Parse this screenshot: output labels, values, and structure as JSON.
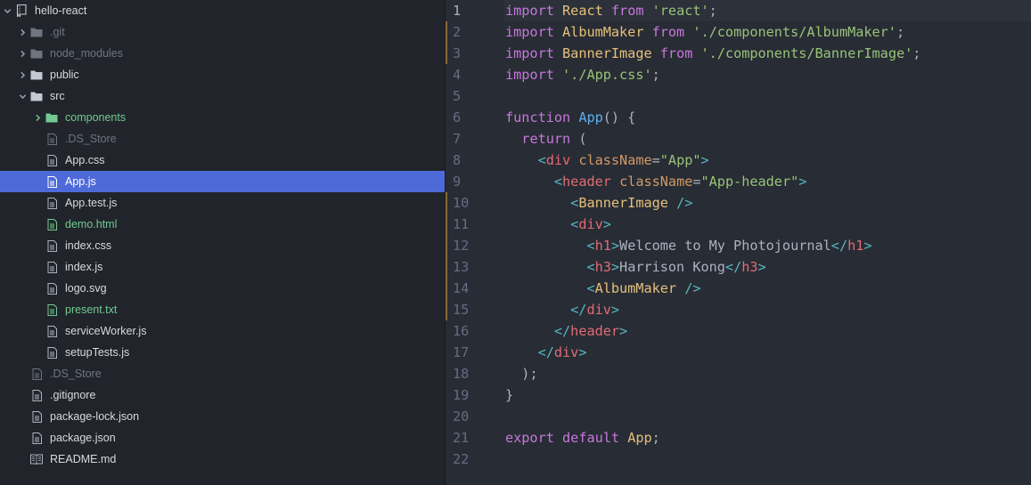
{
  "colors": {
    "tree_bg": "#21252b",
    "editor_bg": "#282c34",
    "selection": "#4e6ad8",
    "added": "#73c991",
    "ignored": "#6e7480",
    "folder": "#9da5b4"
  },
  "tree": [
    {
      "label": "hello-react",
      "depth": 0,
      "kind": "repo",
      "expanded": true,
      "status": "default"
    },
    {
      "label": ".git",
      "depth": 1,
      "kind": "folder",
      "expanded": false,
      "status": "ignored"
    },
    {
      "label": "node_modules",
      "depth": 1,
      "kind": "folder",
      "expanded": false,
      "status": "ignored"
    },
    {
      "label": "public",
      "depth": 1,
      "kind": "folder",
      "expanded": false,
      "status": "default"
    },
    {
      "label": "src",
      "depth": 1,
      "kind": "folder",
      "expanded": true,
      "status": "default"
    },
    {
      "label": "components",
      "depth": 2,
      "kind": "folder",
      "expanded": false,
      "status": "added"
    },
    {
      "label": ".DS_Store",
      "depth": 2,
      "kind": "file",
      "status": "ignored"
    },
    {
      "label": "App.css",
      "depth": 2,
      "kind": "file",
      "status": "default"
    },
    {
      "label": "App.js",
      "depth": 2,
      "kind": "file",
      "status": "selected"
    },
    {
      "label": "App.test.js",
      "depth": 2,
      "kind": "file",
      "status": "default"
    },
    {
      "label": "demo.html",
      "depth": 2,
      "kind": "file",
      "status": "added"
    },
    {
      "label": "index.css",
      "depth": 2,
      "kind": "file",
      "status": "default"
    },
    {
      "label": "index.js",
      "depth": 2,
      "kind": "file",
      "status": "default"
    },
    {
      "label": "logo.svg",
      "depth": 2,
      "kind": "file",
      "status": "default"
    },
    {
      "label": "present.txt",
      "depth": 2,
      "kind": "file",
      "status": "added"
    },
    {
      "label": "serviceWorker.js",
      "depth": 2,
      "kind": "file",
      "status": "default"
    },
    {
      "label": "setupTests.js",
      "depth": 2,
      "kind": "file",
      "status": "default"
    },
    {
      "label": ".DS_Store",
      "depth": 1,
      "kind": "file",
      "status": "ignored"
    },
    {
      "label": ".gitignore",
      "depth": 1,
      "kind": "file",
      "status": "default"
    },
    {
      "label": "package-lock.json",
      "depth": 1,
      "kind": "file",
      "status": "default"
    },
    {
      "label": "package.json",
      "depth": 1,
      "kind": "file",
      "status": "default"
    },
    {
      "label": "README.md",
      "depth": 1,
      "kind": "book",
      "status": "default"
    }
  ],
  "editor": {
    "active_line": 1,
    "modified_lines": [
      2,
      3,
      10,
      11,
      12,
      13,
      14,
      15
    ],
    "lines": [
      {
        "n": "1",
        "tokens": [
          [
            "keyword",
            "import"
          ],
          [
            "text",
            " "
          ],
          [
            "ident",
            "React"
          ],
          [
            "text",
            " "
          ],
          [
            "keyword",
            "from"
          ],
          [
            "text",
            " "
          ],
          [
            "string",
            "'react'"
          ],
          [
            "punct",
            ";"
          ]
        ]
      },
      {
        "n": "2",
        "tokens": [
          [
            "keyword",
            "import"
          ],
          [
            "text",
            " "
          ],
          [
            "ident",
            "AlbumMaker"
          ],
          [
            "text",
            " "
          ],
          [
            "keyword",
            "from"
          ],
          [
            "text",
            " "
          ],
          [
            "string",
            "'./components/AlbumMaker'"
          ],
          [
            "punct",
            ";"
          ]
        ]
      },
      {
        "n": "3",
        "tokens": [
          [
            "keyword",
            "import"
          ],
          [
            "text",
            " "
          ],
          [
            "ident",
            "BannerImage"
          ],
          [
            "text",
            " "
          ],
          [
            "keyword",
            "from"
          ],
          [
            "text",
            " "
          ],
          [
            "string",
            "'./components/BannerImage'"
          ],
          [
            "punct",
            ";"
          ]
        ]
      },
      {
        "n": "4",
        "tokens": [
          [
            "keyword",
            "import"
          ],
          [
            "text",
            " "
          ],
          [
            "string",
            "'./App.css'"
          ],
          [
            "punct",
            ";"
          ]
        ]
      },
      {
        "n": "5",
        "tokens": []
      },
      {
        "n": "6",
        "tokens": [
          [
            "keyword",
            "function"
          ],
          [
            "text",
            " "
          ],
          [
            "fn",
            "App"
          ],
          [
            "punct",
            "() {"
          ]
        ]
      },
      {
        "n": "7",
        "tokens": [
          [
            "text",
            "  "
          ],
          [
            "keyword",
            "return"
          ],
          [
            "punct",
            " ("
          ]
        ]
      },
      {
        "n": "8",
        "tokens": [
          [
            "text",
            "    "
          ],
          [
            "bracket",
            "<"
          ],
          [
            "tag",
            "div"
          ],
          [
            "text",
            " "
          ],
          [
            "attr",
            "className"
          ],
          [
            "punct",
            "="
          ],
          [
            "string",
            "\"App\""
          ],
          [
            "bracket",
            ">"
          ]
        ]
      },
      {
        "n": "9",
        "tokens": [
          [
            "text",
            "      "
          ],
          [
            "bracket",
            "<"
          ],
          [
            "tag",
            "header"
          ],
          [
            "text",
            " "
          ],
          [
            "attr",
            "className"
          ],
          [
            "punct",
            "="
          ],
          [
            "string",
            "\"App-header\""
          ],
          [
            "bracket",
            ">"
          ]
        ]
      },
      {
        "n": "10",
        "tokens": [
          [
            "text",
            "        "
          ],
          [
            "bracket",
            "<"
          ],
          [
            "ident",
            "BannerImage"
          ],
          [
            "text",
            " "
          ],
          [
            "bracket",
            "/>"
          ]
        ]
      },
      {
        "n": "11",
        "tokens": [
          [
            "text",
            "        "
          ],
          [
            "bracket",
            "<"
          ],
          [
            "tag",
            "div"
          ],
          [
            "bracket",
            ">"
          ]
        ]
      },
      {
        "n": "12",
        "tokens": [
          [
            "text",
            "          "
          ],
          [
            "bracket",
            "<"
          ],
          [
            "tag",
            "h1"
          ],
          [
            "bracket",
            ">"
          ],
          [
            "text",
            "Welcome to My Photojournal"
          ],
          [
            "bracket",
            "</"
          ],
          [
            "tag",
            "h1"
          ],
          [
            "bracket",
            ">"
          ]
        ]
      },
      {
        "n": "13",
        "tokens": [
          [
            "text",
            "          "
          ],
          [
            "bracket",
            "<"
          ],
          [
            "tag",
            "h3"
          ],
          [
            "bracket",
            ">"
          ],
          [
            "text",
            "Harrison Kong"
          ],
          [
            "bracket",
            "</"
          ],
          [
            "tag",
            "h3"
          ],
          [
            "bracket",
            ">"
          ]
        ]
      },
      {
        "n": "14",
        "tokens": [
          [
            "text",
            "          "
          ],
          [
            "bracket",
            "<"
          ],
          [
            "ident",
            "AlbumMaker"
          ],
          [
            "text",
            " "
          ],
          [
            "bracket",
            "/>"
          ]
        ]
      },
      {
        "n": "15",
        "tokens": [
          [
            "text",
            "        "
          ],
          [
            "bracket",
            "</"
          ],
          [
            "tag",
            "div"
          ],
          [
            "bracket",
            ">"
          ]
        ]
      },
      {
        "n": "16",
        "tokens": [
          [
            "text",
            "      "
          ],
          [
            "bracket",
            "</"
          ],
          [
            "tag",
            "header"
          ],
          [
            "bracket",
            ">"
          ]
        ]
      },
      {
        "n": "17",
        "tokens": [
          [
            "text",
            "    "
          ],
          [
            "bracket",
            "</"
          ],
          [
            "tag",
            "div"
          ],
          [
            "bracket",
            ">"
          ]
        ]
      },
      {
        "n": "18",
        "tokens": [
          [
            "text",
            "  "
          ],
          [
            "punct",
            ");"
          ]
        ]
      },
      {
        "n": "19",
        "tokens": [
          [
            "punct",
            "}"
          ]
        ]
      },
      {
        "n": "20",
        "tokens": []
      },
      {
        "n": "21",
        "tokens": [
          [
            "keyword",
            "export"
          ],
          [
            "text",
            " "
          ],
          [
            "keyword",
            "default"
          ],
          [
            "text",
            " "
          ],
          [
            "ident",
            "App"
          ],
          [
            "punct",
            ";"
          ]
        ]
      },
      {
        "n": "22",
        "tokens": []
      }
    ]
  }
}
